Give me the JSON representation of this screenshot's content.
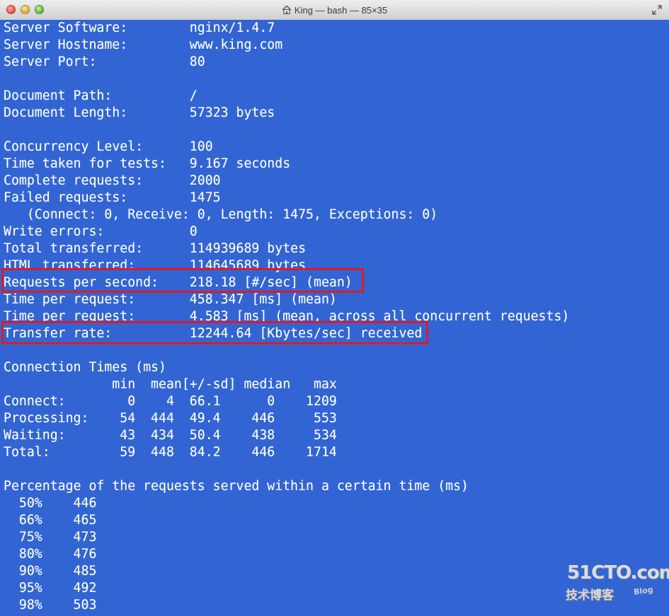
{
  "window": {
    "title": "King — bash — 85×35"
  },
  "terminal": {
    "lines": [
      "Server Software:        nginx/1.4.7",
      "Server Hostname:        www.king.com",
      "Server Port:            80",
      "",
      "Document Path:          /",
      "Document Length:        57323 bytes",
      "",
      "Concurrency Level:      100",
      "Time taken for tests:   9.167 seconds",
      "Complete requests:      2000",
      "Failed requests:        1475",
      "   (Connect: 0, Receive: 0, Length: 1475, Exceptions: 0)",
      "Write errors:           0",
      "Total transferred:      114939689 bytes",
      "HTML transferred:       114645689 bytes",
      "Requests per second:    218.18 [#/sec] (mean)",
      "Time per request:       458.347 [ms] (mean)",
      "Time per request:       4.583 [ms] (mean, across all concurrent requests)",
      "Transfer rate:          12244.64 [Kbytes/sec] received",
      "",
      "Connection Times (ms)",
      "              min  mean[+/-sd] median   max",
      "Connect:        0    4  66.1      0    1209",
      "Processing:    54  444  49.4    446     553",
      "Waiting:       43  434  50.4    438     534",
      "Total:         59  448  84.2    446    1714",
      "",
      "Percentage of the requests served within a certain time (ms)",
      "  50%    446",
      "  66%    465",
      "  75%    473",
      "  80%    476",
      "  90%    485",
      "  95%    492",
      "  98%    503"
    ]
  },
  "watermark": {
    "top": "51CTO.com",
    "bottom": "技术博客",
    "blog": "Blog"
  },
  "colors": {
    "terminal_bg": "#3265d3",
    "text": "#ffffff",
    "highlight": "#e01a22"
  }
}
